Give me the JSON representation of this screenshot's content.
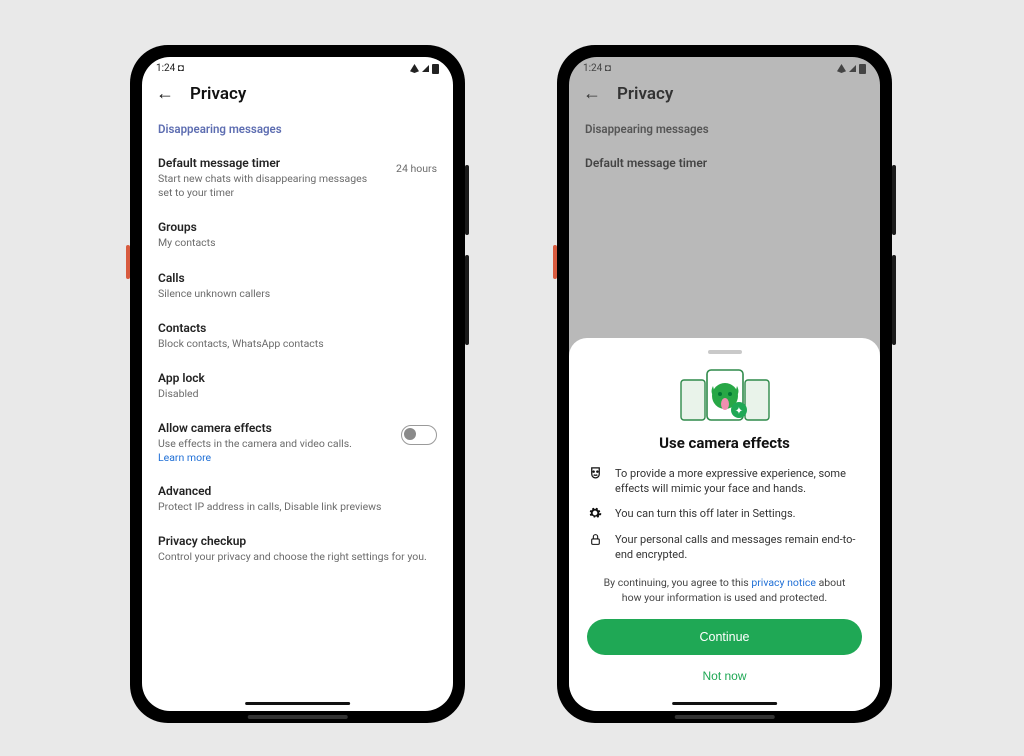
{
  "statusbar": {
    "time": "1:24 ◘"
  },
  "left": {
    "title": "Privacy",
    "section_header": "Disappearing messages",
    "rows": {
      "timer": {
        "title": "Default message timer",
        "subtitle": "Start new chats with disappearing messages set to your timer",
        "value": "24 hours"
      },
      "groups": {
        "title": "Groups",
        "subtitle": "My contacts"
      },
      "calls": {
        "title": "Calls",
        "subtitle": "Silence unknown callers"
      },
      "contacts": {
        "title": "Contacts",
        "subtitle": "Block contacts, WhatsApp contacts"
      },
      "applock": {
        "title": "App lock",
        "subtitle": "Disabled"
      },
      "camera": {
        "title": "Allow camera effects",
        "subtitle": "Use effects in the camera and video calls.",
        "learn": "Learn more"
      },
      "advanced": {
        "title": "Advanced",
        "subtitle": "Protect IP address in calls, Disable link previews"
      },
      "checkup": {
        "title": "Privacy checkup",
        "subtitle": "Control your privacy and choose the right settings for you."
      }
    }
  },
  "right": {
    "title": "Privacy",
    "section_header": "Disappearing messages",
    "dimmed_row": "Default message timer",
    "sheet": {
      "title": "Use camera effects",
      "bullets": [
        "To provide a more expressive experience, some effects will mimic your face and hands.",
        "You can turn this off later in Settings.",
        "Your personal calls and messages remain end-to-end encrypted."
      ],
      "disclaimer_pre": "By continuing, you agree to this ",
      "privacy_link": "privacy notice",
      "disclaimer_post": " about how your information is used and protected.",
      "continue": "Continue",
      "not_now": "Not now"
    }
  }
}
